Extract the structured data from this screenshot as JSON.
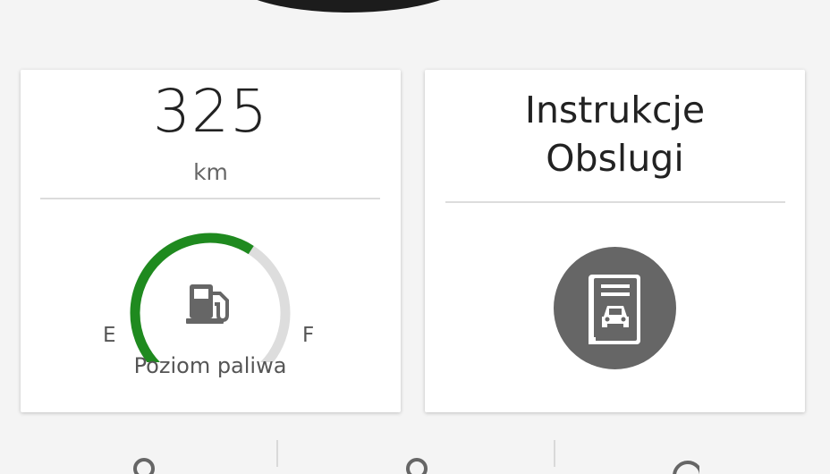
{
  "range": {
    "value": "325",
    "unit": "km"
  },
  "fuel": {
    "empty_label": "E",
    "full_label": "F",
    "title": "Poziom paliwa",
    "level_fraction": 0.6,
    "level_color": "#1f8a1f",
    "track_color": "#dddddd"
  },
  "manual": {
    "title_line1": "Instrukcje",
    "title_line2": "Obslugi",
    "icon": "car-manual-book-icon",
    "icon_bg": "#666666"
  },
  "bottom_nav": {
    "icons": [
      "location-pin-icon",
      "location-pin-icon",
      "circle-icon"
    ]
  }
}
